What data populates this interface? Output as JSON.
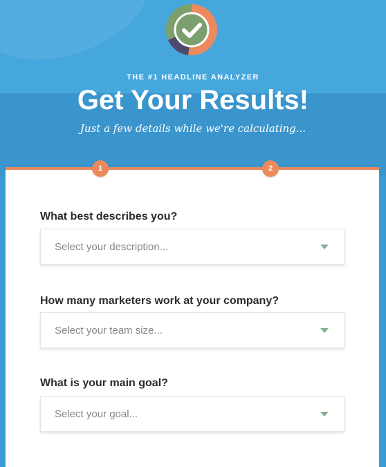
{
  "header": {
    "kicker": "THE #1 HEADLINE ANALYZER",
    "title": "Get Your Results!",
    "subtitle": "Just a few details while we're calculating...",
    "logo_icon": "checkmark-badge-icon"
  },
  "steps": [
    {
      "label": "1"
    },
    {
      "label": "2"
    }
  ],
  "form": {
    "description": {
      "question": "What best describes you?",
      "placeholder": "Select your description..."
    },
    "team_size": {
      "question": "How many marketers work at your company?",
      "placeholder": "Select your team size..."
    },
    "goal": {
      "question": "What is your main goal?",
      "placeholder": "Select your goal..."
    }
  },
  "colors": {
    "background": "#3b9bd4",
    "accent_orange": "#ec8a5e",
    "check_green": "#7c9f6e",
    "card": "#ffffff"
  }
}
